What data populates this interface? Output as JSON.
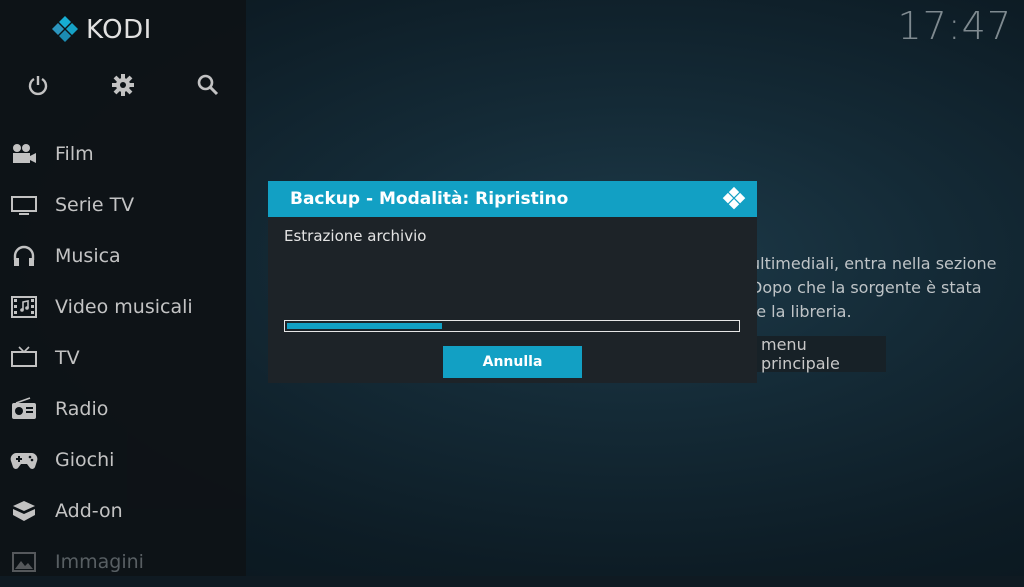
{
  "app": {
    "name": "KODI",
    "clock": "17:47",
    "accent": "#12a0c4"
  },
  "top_icons": [
    "power-icon",
    "gear-icon",
    "search-icon"
  ],
  "sidebar": {
    "items": [
      {
        "label": "Film",
        "icon": "film-icon"
      },
      {
        "label": "Serie TV",
        "icon": "tv-icon"
      },
      {
        "label": "Musica",
        "icon": "headphones-icon"
      },
      {
        "label": "Video musicali",
        "icon": "music-video-icon"
      },
      {
        "label": "TV",
        "icon": "television-icon"
      },
      {
        "label": "Radio",
        "icon": "radio-icon"
      },
      {
        "label": "Giochi",
        "icon": "gamepad-icon"
      },
      {
        "label": "Add-on",
        "icon": "addon-box-icon"
      },
      {
        "label": "Immagini",
        "icon": "image-icon"
      }
    ]
  },
  "background": {
    "text_lines": [
      "ultimediali, entra nella sezione",
      "Dopo che la sorgente è stata",
      "re la libreria."
    ],
    "button_label": "menu principale"
  },
  "dialog": {
    "title": "Backup - Modalità: Ripristino",
    "message": "Estrazione archivio",
    "progress": 0.345,
    "cancel_label": "Annulla"
  }
}
